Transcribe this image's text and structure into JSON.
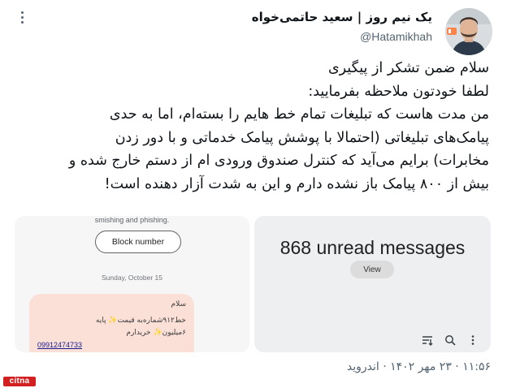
{
  "author": {
    "name": "یک نیم روز | سعید حاتمی‌خواه",
    "handle": "@Hatamikhah"
  },
  "tweet": {
    "lines": [
      "سلام ضمن تشکر از پیگیری",
      "لطفا خودتون ملاحظه بفرمایید:",
      "من مدت هاست که تبلیغات تمام خط هایم را بسته‌ام، اما به حدی",
      "پیامک‌های تبلیغاتی (احتمالا با پوشش پیامک خدماتی و با دور زدن",
      "مخابرات) برایم می‌آید که کنترل صندوق ورودی ام از دستم خارج شده و",
      "بیش از ۸۰۰ پیامک باز نشده دارم و این به شدت آزار دهنده است!"
    ],
    "timestamp": "۱۱:۵۶ · ۲۳ مهر ۱۴۰۲ · اندروید"
  },
  "media_left": {
    "top_text": "smishing and phishing.",
    "block_button": "Block number",
    "date": "Sunday, October 15",
    "message_lines": [
      "سلام",
      "خط۹۱۲شماره‌به قیمت✨ پایه",
      "۶میلیون✨ خریدارم"
    ],
    "phone": "09912474733"
  },
  "media_right": {
    "unread": "868 unread messages",
    "view_button": "View",
    "icons": [
      "filter-icon",
      "search-icon",
      "more-vertical-icon"
    ]
  },
  "watermark": "citna",
  "colors": {
    "text": "#0f1419",
    "secondary": "#536471",
    "bubble": "#fbe0d8",
    "watermark": "#d21f1f"
  }
}
